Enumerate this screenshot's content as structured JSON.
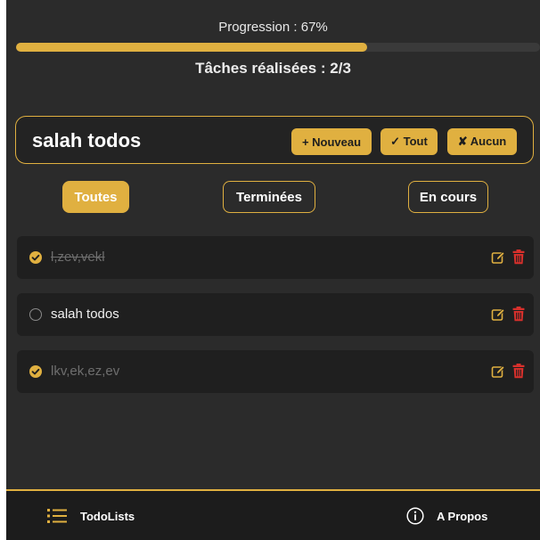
{
  "progress": {
    "label": "Progression : 67%",
    "value_percent": 67,
    "done_label": "Tâches réalisées : 2/3"
  },
  "list": {
    "name": "salah todos",
    "buttons": {
      "new": "+ Nouveau",
      "all": "✓ Tout",
      "none": "✘ Aucun"
    }
  },
  "filters": [
    {
      "label": "Toutes",
      "active": true
    },
    {
      "label": "Terminées",
      "active": false
    },
    {
      "label": "En cours",
      "active": false
    }
  ],
  "tasks": [
    {
      "label": "l,zev,vekl",
      "done": true
    },
    {
      "label": "salah todos",
      "done": false
    },
    {
      "label": "lkv,ek,ez,ev",
      "done": true
    }
  ],
  "nav": {
    "todolists": "TodoLists",
    "about": "A Propos"
  },
  "colors": {
    "accent": "#e0b040",
    "background": "#2b2b2b",
    "card": "#1f1f1f",
    "delete": "#d9302c"
  },
  "icons": {
    "check": "check-circle-icon",
    "edit": "edit-icon",
    "delete": "trash-icon",
    "list": "list-icon",
    "info": "info-icon"
  }
}
